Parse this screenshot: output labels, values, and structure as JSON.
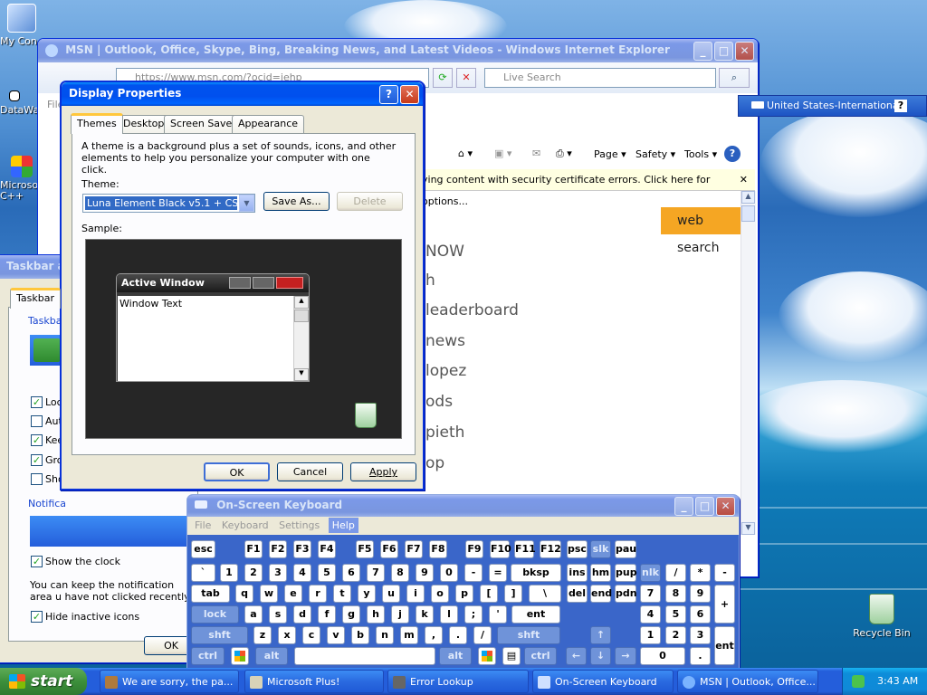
{
  "desktop": {
    "icons": [
      {
        "label": "My Con"
      },
      {
        "label": "DataWa"
      },
      {
        "label": "Microsoft C++"
      },
      {
        "label": "Recycle Bin"
      }
    ]
  },
  "ie": {
    "title": "MSN | Outlook, Office, Skype, Bing, Breaking News, and Latest Videos - Windows Internet Explorer",
    "address": "https://www.msn.com/?ocid=iehp",
    "search_placeholder": "Live Search",
    "file_menu": "File",
    "toolbar": {
      "page": "Page",
      "safety": "Safety",
      "tools": "Tools"
    },
    "infobar": "ying content with security certificate errors. Click here for options...",
    "web_search": "web search",
    "list": [
      "NOW",
      "h",
      "leaderboard",
      "news",
      "lopez",
      "ods",
      "pieth",
      "op"
    ]
  },
  "language_bar": {
    "label": "United States-International",
    "help": "?"
  },
  "display_props": {
    "title": "Display Properties",
    "tabs": [
      "Themes",
      "Desktop",
      "Screen Saver",
      "Appearance"
    ],
    "description": "A theme is a background plus a set of sounds, icons, and other elements to help you personalize your computer with one click.",
    "theme_label": "Theme:",
    "theme_value": "Luna Element Black v5.1 + CSS",
    "save_as": "Save As...",
    "delete": "Delete",
    "sample_label": "Sample:",
    "sample_window_title": "Active Window",
    "sample_window_text": "Window Text",
    "ok": "OK",
    "cancel": "Cancel",
    "apply": "Apply"
  },
  "taskbar_props": {
    "title": "Taskbar a",
    "tab": "Taskbar",
    "group1": "Taskba",
    "options": [
      {
        "label": "Loc",
        "checked": true
      },
      {
        "label": "Aut",
        "checked": false
      },
      {
        "label": "Kee",
        "checked": true
      },
      {
        "label": "Gro",
        "checked": true
      },
      {
        "label": "Sho",
        "checked": false
      }
    ],
    "group2": "Notifica",
    "show_clock": "Show the clock",
    "note": "You can keep the notification area u have not clicked recently.",
    "hide_inactive": "Hide inactive icons",
    "ok": "OK"
  },
  "osk": {
    "title": "On-Screen Keyboard",
    "menu": [
      "File",
      "Keyboard",
      "Settings",
      "Help"
    ],
    "rows": {
      "r1": [
        "esc",
        "F1",
        "F2",
        "F3",
        "F4",
        "F5",
        "F6",
        "F7",
        "F8",
        "F9",
        "F10",
        "F11",
        "F12",
        "psc",
        "slk",
        "pau"
      ],
      "r2": [
        "`",
        "1",
        "2",
        "3",
        "4",
        "5",
        "6",
        "7",
        "8",
        "9",
        "0",
        "-",
        "=",
        "bksp",
        "ins",
        "hm",
        "pup",
        "nlk",
        "/",
        "*",
        "-"
      ],
      "r3": [
        "tab",
        "q",
        "w",
        "e",
        "r",
        "t",
        "y",
        "u",
        "i",
        "o",
        "p",
        "[",
        "]",
        "\\",
        "del",
        "end",
        "pdn",
        "7",
        "8",
        "9",
        "+"
      ],
      "r4": [
        "lock",
        "a",
        "s",
        "d",
        "f",
        "g",
        "h",
        "j",
        "k",
        "l",
        ";",
        "'",
        "ent",
        "4",
        "5",
        "6"
      ],
      "r5": [
        "shft",
        "z",
        "x",
        "c",
        "v",
        "b",
        "n",
        "m",
        ",",
        ".",
        "/",
        "shft",
        "↑",
        "1",
        "2",
        "3",
        "ent"
      ],
      "r6": [
        "ctrl",
        "alt",
        "alt",
        "ctrl",
        "←",
        "↓",
        "→",
        "0",
        "."
      ]
    }
  },
  "taskbar": {
    "start": "start",
    "items": [
      "We are sorry, the pa...",
      "Microsoft Plus!",
      "Error Lookup",
      "On-Screen Keyboard",
      "MSN | Outlook, Office..."
    ],
    "clock": "3:43 AM"
  }
}
